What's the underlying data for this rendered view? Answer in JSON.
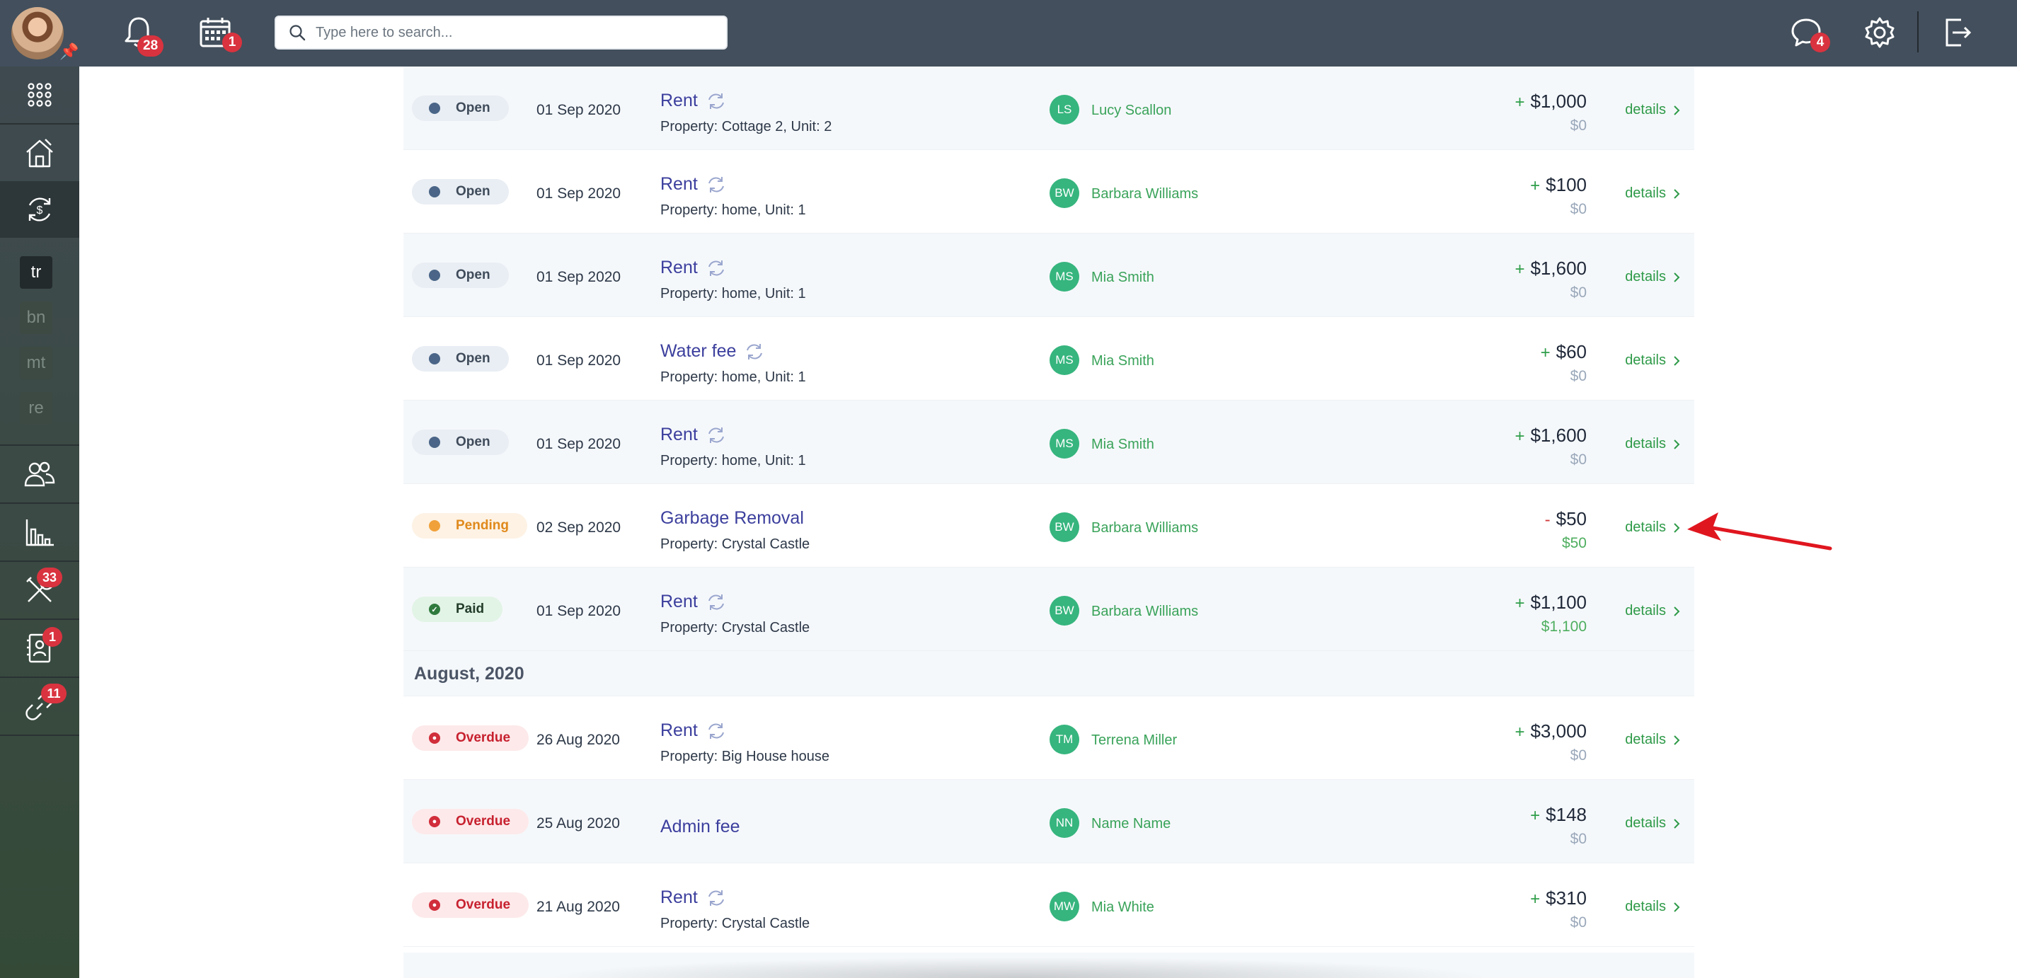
{
  "header": {
    "notifications_count": "28",
    "calendar_count": "1",
    "search_placeholder": "Type here to search...",
    "messages_count": "4"
  },
  "sidebar": {
    "codes": [
      "tr",
      "bn",
      "mt",
      "re"
    ],
    "maintenance_count": "33",
    "contacts_count": "1",
    "tools_count": "11"
  },
  "rows": [
    {
      "status": "Open",
      "date": "01 Sep 2020",
      "title": "Rent",
      "recurring": true,
      "property": "Property: Cottage 2, Unit: 2",
      "initials": "LS",
      "name": "Lucy Scallon",
      "sign": "+",
      "amount": "$1,000",
      "paid": "$0",
      "details": "details"
    },
    {
      "status": "Open",
      "date": "01 Sep 2020",
      "title": "Rent",
      "recurring": true,
      "property": "Property: home, Unit: 1",
      "initials": "BW",
      "name": "Barbara Williams",
      "sign": "+",
      "amount": "$100",
      "paid": "$0",
      "details": "details"
    },
    {
      "status": "Open",
      "date": "01 Sep 2020",
      "title": "Rent",
      "recurring": true,
      "property": "Property: home, Unit: 1",
      "initials": "MS",
      "name": "Mia Smith",
      "sign": "+",
      "amount": "$1,600",
      "paid": "$0",
      "details": "details"
    },
    {
      "status": "Open",
      "date": "01 Sep 2020",
      "title": "Water fee",
      "recurring": true,
      "property": "Property: home, Unit: 1",
      "initials": "MS",
      "name": "Mia Smith",
      "sign": "+",
      "amount": "$60",
      "paid": "$0",
      "details": "details"
    },
    {
      "status": "Open",
      "date": "01 Sep 2020",
      "title": "Rent",
      "recurring": true,
      "property": "Property: home, Unit: 1",
      "initials": "MS",
      "name": "Mia Smith",
      "sign": "+",
      "amount": "$1,600",
      "paid": "$0",
      "details": "details"
    },
    {
      "status": "Pending",
      "date": "02 Sep 2020",
      "title": "Garbage Removal",
      "recurring": false,
      "property": "Property: Crystal Castle",
      "initials": "BW",
      "name": "Barbara Williams",
      "sign": "-",
      "amount": "$50",
      "paid": "$50",
      "details": "details"
    },
    {
      "status": "Paid",
      "date": "01 Sep 2020",
      "title": "Rent",
      "recurring": true,
      "property": "Property: Crystal Castle",
      "initials": "BW",
      "name": "Barbara Williams",
      "sign": "+",
      "amount": "$1,100",
      "paid": "$1,100",
      "details": "details"
    }
  ],
  "month_header": "August, 2020",
  "rows_august": [
    {
      "status": "Overdue",
      "date": "26 Aug 2020",
      "title": "Rent",
      "recurring": true,
      "property": "Property: Big House house",
      "initials": "TM",
      "name": "Terrena Miller",
      "sign": "+",
      "amount": "$3,000",
      "paid": "$0",
      "details": "details"
    },
    {
      "status": "Overdue",
      "date": "25 Aug 2020",
      "title": "Admin fee",
      "recurring": false,
      "property": "",
      "initials": "NN",
      "name": "Name Name",
      "sign": "+",
      "amount": "$148",
      "paid": "$0",
      "details": "details"
    },
    {
      "status": "Overdue",
      "date": "21 Aug 2020",
      "title": "Rent",
      "recurring": true,
      "property": "Property: Crystal Castle",
      "initials": "MW",
      "name": "Mia White",
      "sign": "+",
      "amount": "$310",
      "paid": "$0",
      "details": "details"
    }
  ],
  "colors": {
    "topbar": "#434f5c",
    "accent_green": "#36b57e",
    "link_blue": "#3c3f9d",
    "badge_red": "#d9333f",
    "annotation_arrow": "#e0161f"
  }
}
